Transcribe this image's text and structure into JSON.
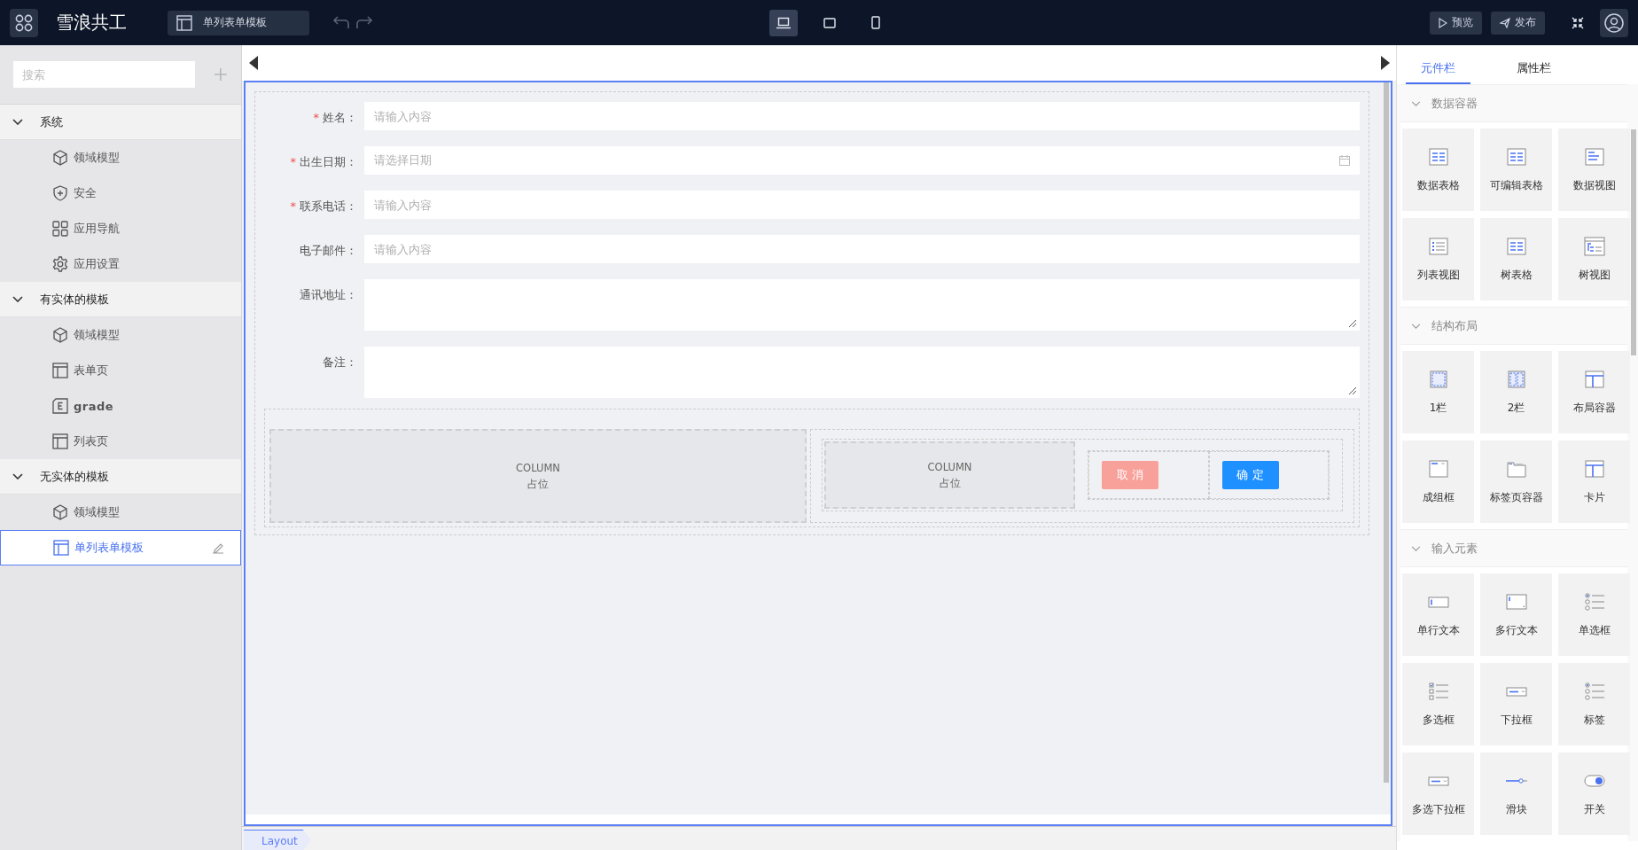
{
  "header": {
    "app_title": "雪浪共工",
    "page_tab": "单列表单模板",
    "devices": [
      {
        "kind": "desktop",
        "selected": true
      },
      {
        "kind": "tablet",
        "selected": false
      },
      {
        "kind": "mobile",
        "selected": false
      }
    ],
    "actions": [
      {
        "kind": "preview",
        "label": "预览"
      },
      {
        "kind": "publish",
        "label": "发布"
      }
    ]
  },
  "sidebar": {
    "search": {
      "placeholder": "搜索"
    },
    "groups": [
      {
        "label": "系统",
        "expanded": true,
        "children": [
          {
            "label": "领域模型",
            "kind": "cube",
            "selected": false
          },
          {
            "label": "安全",
            "kind": "shield",
            "selected": false
          },
          {
            "label": "应用导航",
            "kind": "grid",
            "selected": false
          },
          {
            "label": "应用设置",
            "kind": "gear",
            "selected": false
          }
        ]
      },
      {
        "label": "有实体的模板",
        "expanded": true,
        "children": [
          {
            "label": "领域模型",
            "kind": "cube",
            "selected": false
          },
          {
            "label": "表单页",
            "kind": "layout",
            "selected": false
          },
          {
            "label": "grade",
            "kind": "entity",
            "selected": false
          },
          {
            "label": "列表页",
            "kind": "layout",
            "selected": false
          }
        ]
      },
      {
        "label": "无实体的模板",
        "expanded": true,
        "children": [
          {
            "label": "领域模型",
            "kind": "cube",
            "selected": false
          },
          {
            "label": "单列表单模板",
            "kind": "layout",
            "selected": true
          }
        ]
      }
    ]
  },
  "form": {
    "fields": [
      {
        "label": "姓名：",
        "required_mark": "*",
        "kind": "input",
        "placeholder": "请输入内容"
      },
      {
        "label": "出生日期：",
        "required_mark": "*",
        "kind": "date",
        "placeholder": "请选择日期"
      },
      {
        "label": "联系电话：",
        "required_mark": "*",
        "kind": "input",
        "placeholder": "请输入内容"
      },
      {
        "label": "电子邮件：",
        "kind": "input",
        "placeholder": "请输入内容"
      },
      {
        "label": "通讯地址：",
        "kind": "textarea"
      },
      {
        "label": "备注：",
        "kind": "textarea"
      }
    ],
    "columns": [
      {
        "title": "COLUMN",
        "subtitle": "占位"
      },
      {
        "title": "COLUMN",
        "subtitle": "占位"
      }
    ],
    "buttons": [
      {
        "label": "取 消",
        "kind": "cancel"
      },
      {
        "label": "确 定",
        "kind": "primary"
      }
    ]
  },
  "breadcrumb": "Layout",
  "panel": {
    "tabs": [
      {
        "label": "元件栏",
        "selected": true
      },
      {
        "label": "属性栏",
        "selected": false
      }
    ],
    "sections": [
      {
        "title": "数据容器",
        "expanded": true,
        "items": [
          {
            "label": "数据表格",
            "kind": "table"
          },
          {
            "label": "可编辑表格",
            "kind": "table"
          },
          {
            "label": "数据视图",
            "kind": "dataview"
          },
          {
            "label": "列表视图",
            "kind": "list"
          },
          {
            "label": "树表格",
            "kind": "table"
          },
          {
            "label": "树视图",
            "kind": "tree"
          }
        ]
      },
      {
        "title": "结构布局",
        "expanded": true,
        "items": [
          {
            "label": "1栏",
            "kind": "col1"
          },
          {
            "label": "2栏",
            "kind": "col2"
          },
          {
            "label": "布局容器",
            "kind": "layout"
          },
          {
            "label": "成组框",
            "kind": "group"
          },
          {
            "label": "标签页容器",
            "kind": "tabs"
          },
          {
            "label": "卡片",
            "kind": "layout"
          }
        ]
      },
      {
        "title": "输入元素",
        "expanded": true,
        "items": [
          {
            "label": "单行文本",
            "kind": "text"
          },
          {
            "label": "多行文本",
            "kind": "textarea"
          },
          {
            "label": "单选框",
            "kind": "radio"
          },
          {
            "label": "多选框",
            "kind": "checkbox"
          },
          {
            "label": "下拉框",
            "kind": "select"
          },
          {
            "label": "标签",
            "kind": "radio"
          },
          {
            "label": "多选下拉框",
            "kind": "select"
          },
          {
            "label": "滑块",
            "kind": "slider"
          },
          {
            "label": "开关",
            "kind": "switch"
          }
        ]
      }
    ]
  }
}
